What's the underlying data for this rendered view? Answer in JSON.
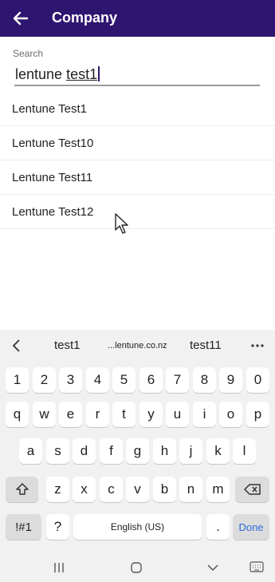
{
  "header": {
    "title": "Company"
  },
  "search": {
    "label": "Search",
    "value_plain": "lentune ",
    "value_underlined": "test1"
  },
  "results": [
    "Lentune Test1",
    "Lentune Test10",
    "Lentune Test11",
    "Lentune Test12"
  ],
  "keyboard": {
    "suggestions": [
      "test1",
      "...lentune.co.nz",
      "test11"
    ],
    "row_numbers": [
      "1",
      "2",
      "3",
      "4",
      "5",
      "6",
      "7",
      "8",
      "9",
      "0"
    ],
    "row_q": [
      "q",
      "w",
      "e",
      "r",
      "t",
      "y",
      "u",
      "i",
      "o",
      "p"
    ],
    "row_a": [
      "a",
      "s",
      "d",
      "f",
      "g",
      "h",
      "j",
      "k",
      "l"
    ],
    "row_z": [
      "z",
      "x",
      "c",
      "v",
      "b",
      "n",
      "m"
    ],
    "symbols_label": "!#1",
    "question": "?",
    "space_label": "English (US)",
    "period": ".",
    "done_label": "Done"
  }
}
